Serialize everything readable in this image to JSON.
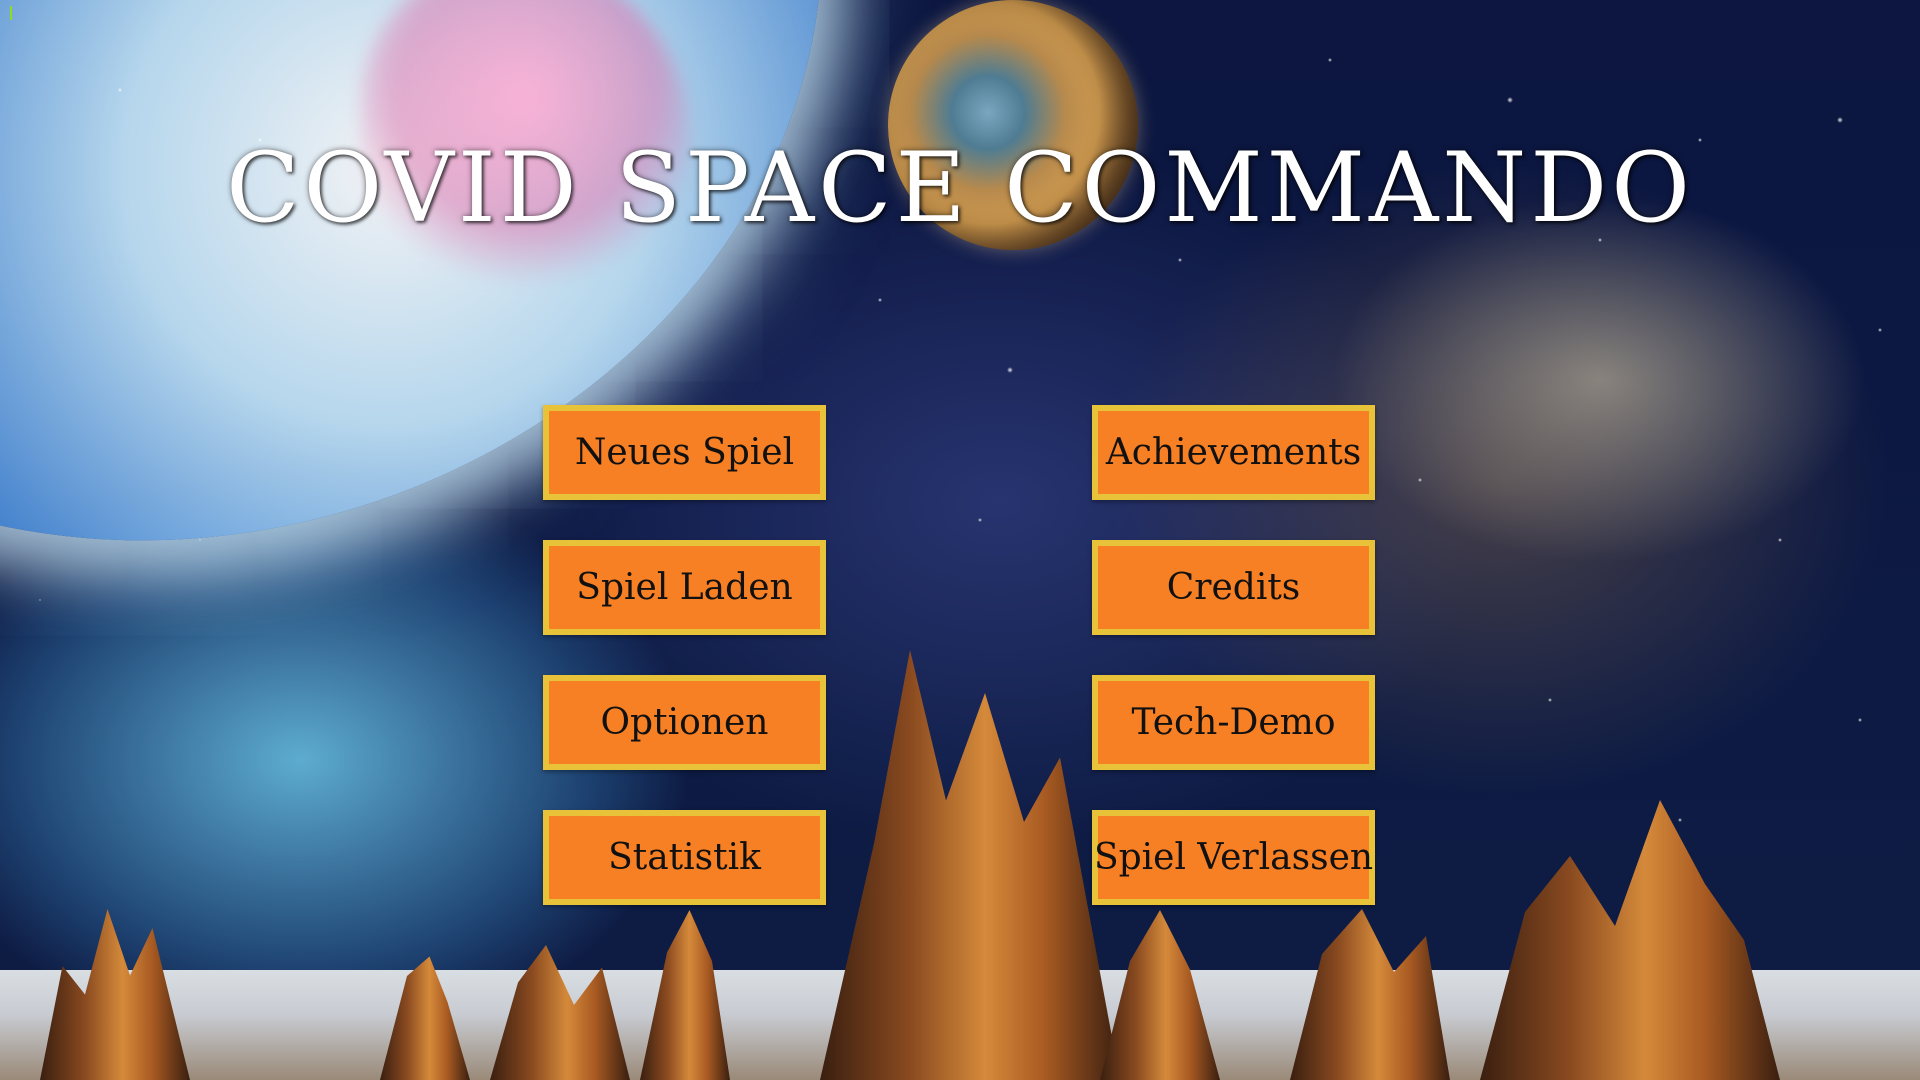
{
  "title": "COVID SPACE COMMANDO",
  "menu": {
    "left": [
      {
        "label": "Neues Spiel"
      },
      {
        "label": "Spiel Laden"
      },
      {
        "label": "Optionen"
      },
      {
        "label": "Statistik"
      }
    ],
    "right": [
      {
        "label": "Achievements"
      },
      {
        "label": "Credits"
      },
      {
        "label": "Tech-Demo"
      },
      {
        "label": "Spiel Verlassen"
      }
    ]
  },
  "colors": {
    "button_fill": "#f77f24",
    "button_border": "#e8c239",
    "title_text": "#ffffff"
  },
  "background": {
    "icons": [
      "large-planet",
      "small-planet",
      "nebula",
      "stars",
      "rock-spires",
      "ground-plain"
    ]
  }
}
